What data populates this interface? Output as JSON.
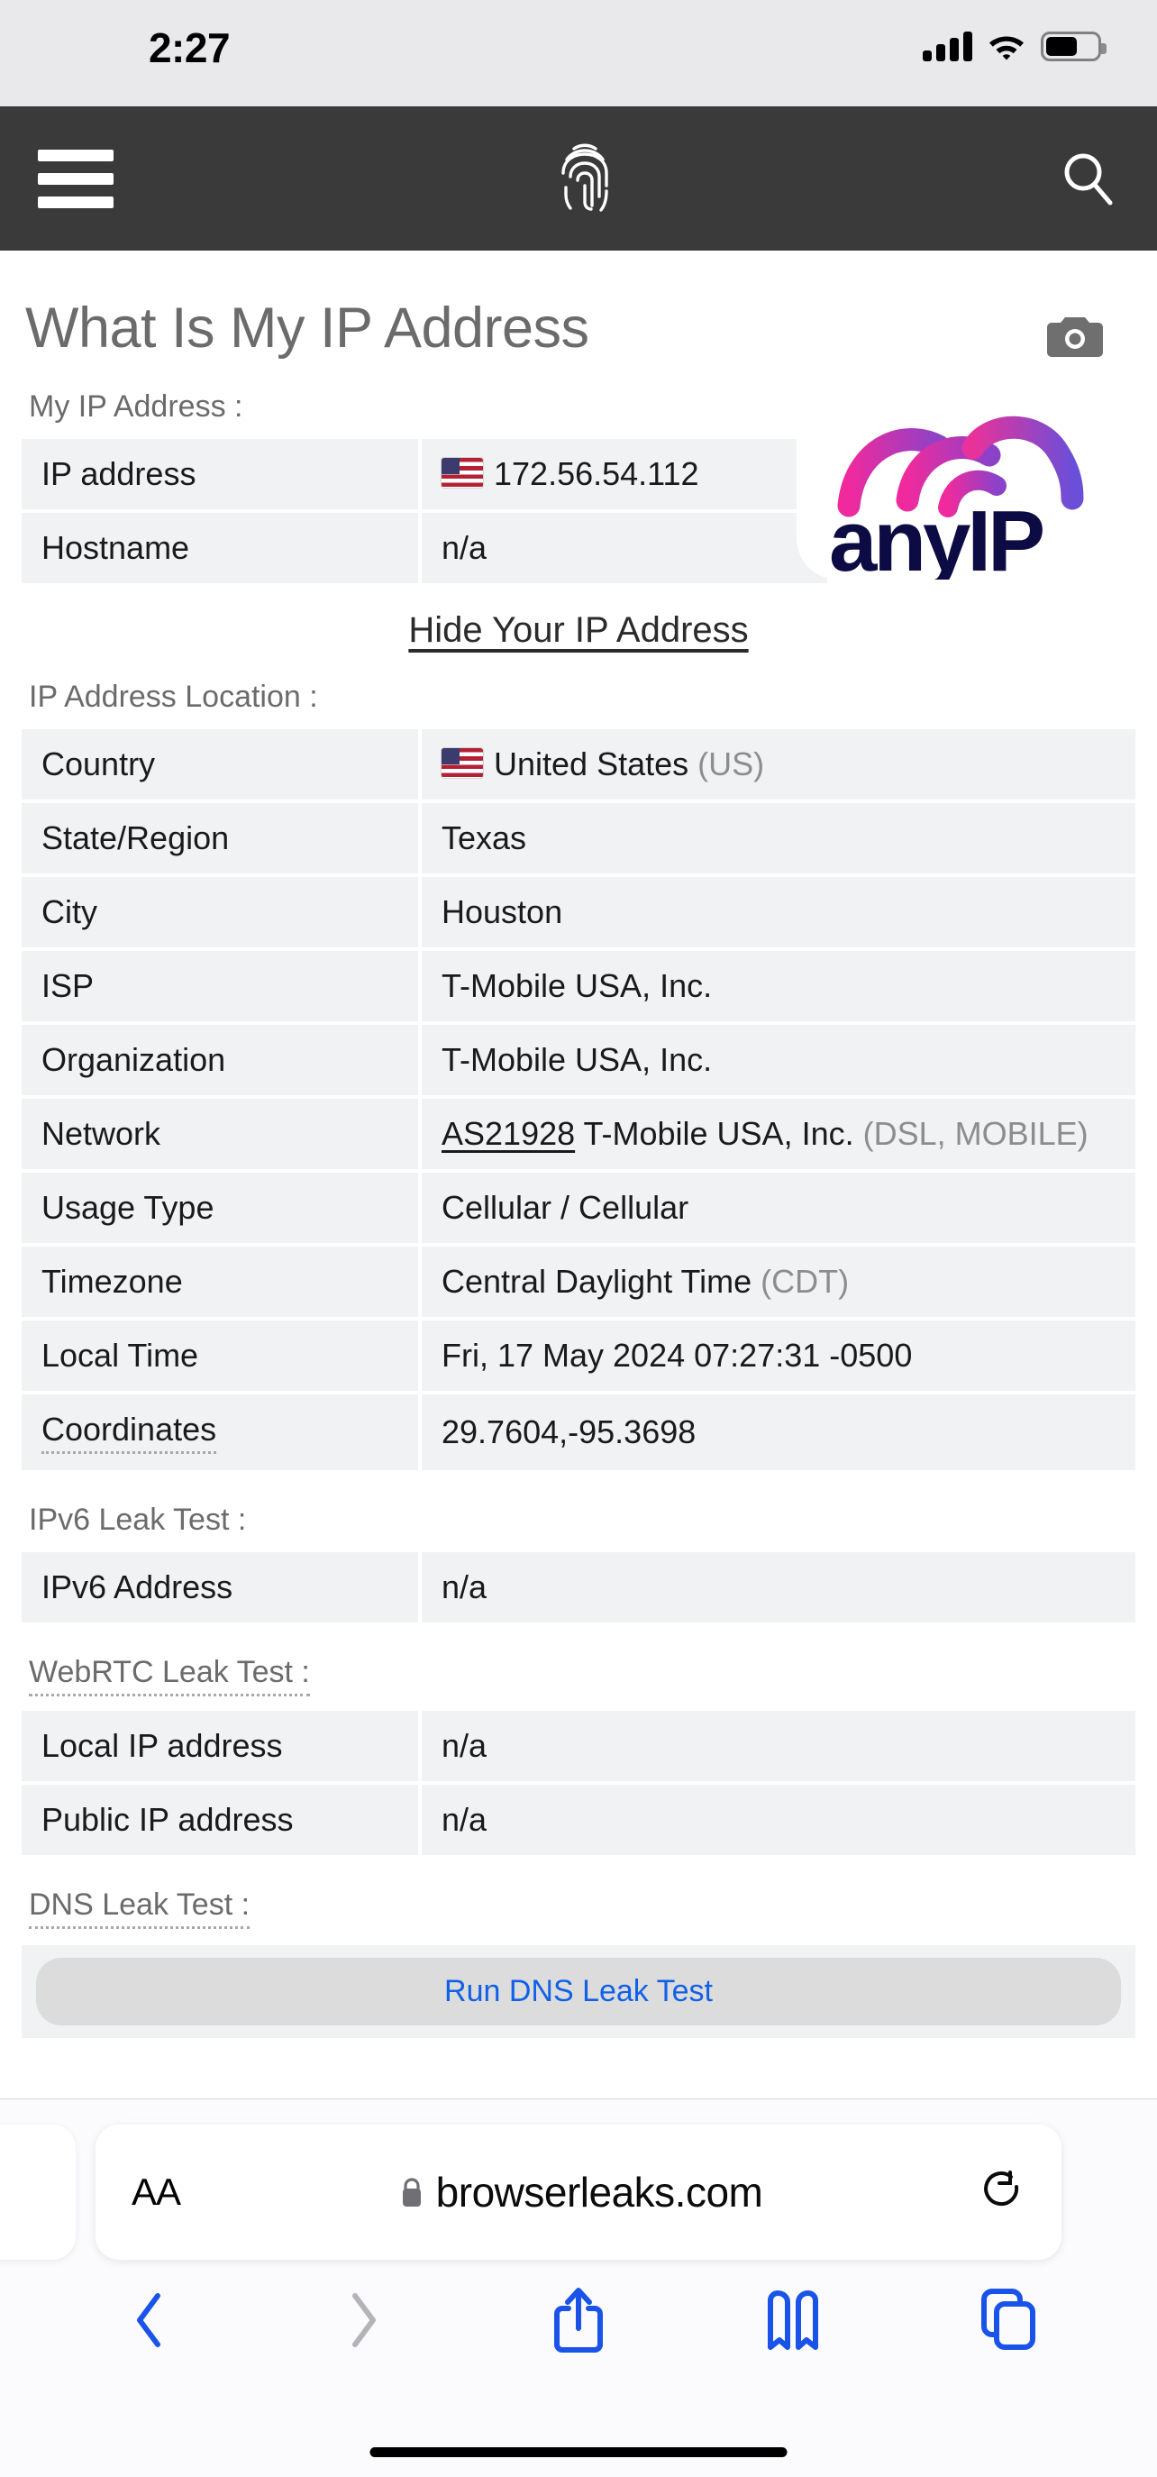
{
  "status_bar": {
    "time": "2:27",
    "signal_icon": "cellular-signal-icon",
    "wifi_icon": "wifi-icon",
    "battery_icon": "battery-icon"
  },
  "site_header": {
    "menu_icon": "hamburger-menu-icon",
    "logo_icon": "fingerprint-logo-icon",
    "search_icon": "search-icon"
  },
  "page": {
    "title": "What Is My IP Address",
    "screenshot_icon": "camera-icon"
  },
  "my_ip": {
    "label": "My IP Address :",
    "rows": [
      {
        "key": "IP address",
        "value": "172.56.54.112",
        "flag": true
      },
      {
        "key": "Hostname",
        "value": "n/a",
        "flag": false
      }
    ],
    "ad": {
      "brand": "anyIP"
    }
  },
  "hide_ip_link": "Hide Your IP Address",
  "location": {
    "label": "IP Address Location :",
    "rows": [
      {
        "key": "Country",
        "value": "United States",
        "suffix": "(US)",
        "flag": true
      },
      {
        "key": "State/Region",
        "value": "Texas"
      },
      {
        "key": "City",
        "value": "Houston"
      },
      {
        "key": "ISP",
        "value": "T-Mobile USA, Inc."
      },
      {
        "key": "Organization",
        "value": "T-Mobile USA, Inc."
      },
      {
        "key": "Network",
        "link": "AS21928",
        "value": "T-Mobile USA, Inc.",
        "suffix": "(DSL, MOBILE)"
      },
      {
        "key": "Usage Type",
        "value": "Cellular / Cellular"
      },
      {
        "key": "Timezone",
        "value": "Central Daylight Time",
        "suffix": "(CDT)"
      },
      {
        "key": "Local Time",
        "value": "Fri, 17 May 2024 07:27:31 -0500"
      },
      {
        "key": "Coordinates",
        "value": "29.7604,-95.3698",
        "key_dotted": true
      }
    ]
  },
  "ipv6": {
    "label": "IPv6 Leak Test :",
    "rows": [
      {
        "key": "IPv6 Address",
        "value": "n/a"
      }
    ]
  },
  "webrtc": {
    "label": "WebRTC Leak Test :",
    "rows": [
      {
        "key": "Local IP address",
        "value": "n/a"
      },
      {
        "key": "Public IP address",
        "value": "n/a"
      }
    ]
  },
  "dns": {
    "label": "DNS Leak Test :",
    "button_label": "Run DNS Leak Test"
  },
  "browser": {
    "text_size_label": "AA",
    "lock_icon": "lock-icon",
    "url": "browserleaks.com",
    "reload_icon": "reload-icon",
    "toolbar": {
      "back_icon": "back-chevron-icon",
      "forward_icon": "forward-chevron-icon",
      "share_icon": "share-icon",
      "bookmarks_icon": "bookmarks-icon",
      "tabs_icon": "tabs-icon"
    }
  },
  "colors": {
    "header_bg": "#3a3a3a",
    "status_bg": "#e9e9eb",
    "row_bg": "#f1f2f3",
    "link_blue": "#1161e6",
    "toolbar_blue": "#1a53e8",
    "muted_text": "#8d8d8d",
    "title_gray": "#6b6b6b",
    "anyip_navy": "#0d0b44",
    "anyip_pink": "#e8329a",
    "anyip_purple": "#6b4fd8"
  }
}
